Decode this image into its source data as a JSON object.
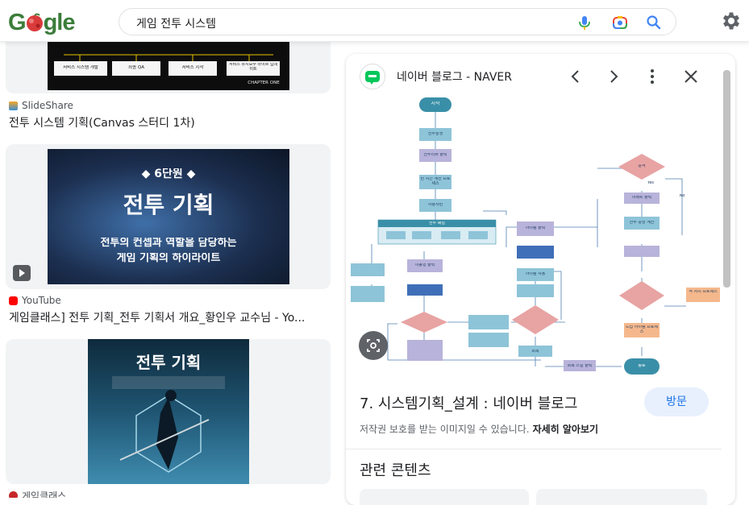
{
  "header": {
    "logo_text": "Google",
    "query": "게임 전투 시스템",
    "icons": [
      "mic-icon",
      "google-lens-icon",
      "search-icon",
      "gear-icon"
    ]
  },
  "results": [
    {
      "source": "SlideShare",
      "title": "전투 시스템 기획(Canvas 스터디 1차)",
      "thumb": {
        "boxes": [
          "서비스 시스템 개발",
          "최종 QA",
          "서비스 시작",
          "서비스 유지보수 라이브 업데이트"
        ],
        "caption": "CHAPTER ONE"
      }
    },
    {
      "source": "YouTube",
      "title": "게임클래스] 전투 기획_전투 기획서 개요_황인우 교수님 - Yo...",
      "thumb": {
        "tag": "◆ 6단원 ◆",
        "headline": "전투 기획",
        "sub1": "전투의 컨셉과 역할을 담당하는",
        "sub2": "게임 기획의 하이라이트"
      }
    },
    {
      "source": "게임클래스",
      "title": "",
      "thumb": {
        "headline": "전투 기획"
      }
    }
  ],
  "panel": {
    "site": "네이버 블로그 - NAVER",
    "title": "7. 시스템기획_설계 : 네이버 블로그",
    "visit_label": "방문",
    "copyright": "저작권 보호를 받는 이미지일 수 있습니다.",
    "learn_more": "자세히 알아보기",
    "related": "관련 콘텐츠",
    "flowchart": {
      "nodes": [
        "시작",
        "전투발생",
        "전투리뷰 출력",
        "턴 시간 계산 프로세스",
        "사용자턴",
        "전투 패널",
        "이동형 출력",
        "아이템 출력",
        "아이템 사용",
        "회복",
        "회복 스킬 출력",
        "종료",
        "공격",
        "이펙트 출력",
        "전투 공방 계산",
        "드랍 아이템 프로세스",
        "적 처치 프로세스"
      ],
      "labels": [
        "Yes",
        "No"
      ]
    }
  },
  "colors": {
    "accent": "#1a73e8",
    "visit_bg": "#e8f0fe",
    "card_bg": "#f1f3f4",
    "flow_blue": "#8ec4d8",
    "flow_diamond": "#e8a3a3",
    "flow_purple": "#b8b3da",
    "flow_orange": "#f5b88c"
  }
}
